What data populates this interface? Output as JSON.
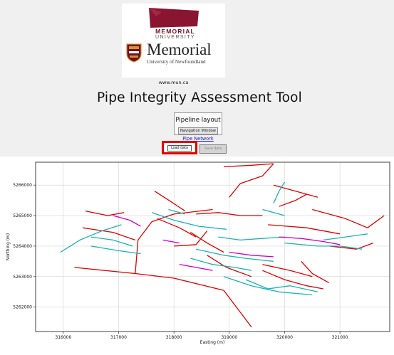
{
  "logo": {
    "banner_line1": "MEMORIAL",
    "banner_line2": "UNIVERSITY",
    "name": "Memorial",
    "subtitle": "University of Newfoundland",
    "url": "www.mun.ca"
  },
  "app": {
    "title": "Pipe Integrity Assessment Tool"
  },
  "panel": {
    "layout_button": "Pipeline layout",
    "navigation_button": "Navigation Window",
    "pipe_network_link": "Pipe Network",
    "load_button": "Load data",
    "save_button": "Save data"
  },
  "colors": {
    "highlight": "#e00000",
    "brand": "#7a0b26",
    "series_red": "#e00000",
    "series_cyan": "#1ab3b3",
    "series_magenta": "#cc00cc"
  },
  "chart_data": {
    "type": "line",
    "title": "",
    "xlabel": "Easting (m)",
    "ylabel": "Northing (m)",
    "xlim": [
      315500,
      321900
    ],
    "ylim": [
      5261200,
      5266750
    ],
    "xticks": [
      316000,
      317000,
      318000,
      319000,
      320000,
      321000
    ],
    "yticks": [
      5262000,
      5263000,
      5264000,
      5265000,
      5266000
    ],
    "grid": true,
    "series": [
      {
        "color": "#e00000",
        "lines": [
          [
            [
              316200,
              5263300
            ],
            [
              317300,
              5263100
            ],
            [
              318000,
              5262950
            ],
            [
              318900,
              5262550
            ],
            [
              319400,
              5261350
            ]
          ],
          [
            [
              317300,
              5263100
            ],
            [
              317350,
              5264200
            ],
            [
              317600,
              5264800
            ]
          ],
          [
            [
              317600,
              5264800
            ],
            [
              318000,
              5265050
            ],
            [
              318700,
              5265200
            ]
          ],
          [
            [
              316350,
              5264600
            ],
            [
              316900,
              5264450
            ],
            [
              317300,
              5264200
            ]
          ],
          [
            [
              318900,
              5266600
            ],
            [
              319400,
              5266650
            ],
            [
              319800,
              5266700
            ]
          ],
          [
            [
              319000,
              5265600
            ],
            [
              319200,
              5266050
            ],
            [
              319600,
              5266300
            ],
            [
              319800,
              5266700
            ]
          ],
          [
            [
              319800,
              5266000
            ],
            [
              320200,
              5265800
            ],
            [
              320600,
              5265600
            ]
          ],
          [
            [
              320500,
              5265200
            ],
            [
              321100,
              5264900
            ],
            [
              321500,
              5264600
            ],
            [
              321800,
              5265000
            ]
          ],
          [
            [
              320800,
              5264000
            ],
            [
              321300,
              5263900
            ],
            [
              321600,
              5264100
            ]
          ],
          [
            [
              318600,
              5264500
            ],
            [
              318400,
              5264050
            ],
            [
              318000,
              5264000
            ]
          ],
          [
            [
              319700,
              5264700
            ],
            [
              320400,
              5264600
            ],
            [
              321000,
              5264400
            ]
          ],
          [
            [
              318600,
              5263700
            ],
            [
              318950,
              5263300
            ],
            [
              319400,
              5263000
            ]
          ],
          [
            [
              319600,
              5263200
            ],
            [
              320000,
              5262900
            ],
            [
              320400,
              5262700
            ],
            [
              320700,
              5262600
            ]
          ],
          [
            [
              319600,
              5263400
            ],
            [
              320100,
              5263200
            ],
            [
              320500,
              5263000
            ]
          ],
          [
            [
              318300,
              5264450
            ],
            [
              318600,
              5264100
            ],
            [
              318900,
              5263800
            ]
          ],
          [
            [
              320800,
              5262800
            ],
            [
              320500,
              5263100
            ],
            [
              320300,
              5263500
            ]
          ],
          [
            [
              318400,
              5265050
            ],
            [
              318800,
              5265100
            ],
            [
              319200,
              5265000
            ],
            [
              319600,
              5265000
            ]
          ],
          [
            [
              317700,
              5264900
            ],
            [
              318100,
              5264600
            ],
            [
              318400,
              5264300
            ]
          ],
          [
            [
              316400,
              5265150
            ],
            [
              316800,
              5265000
            ],
            [
              317100,
              5265100
            ]
          ],
          [
            [
              317650,
              5265800
            ],
            [
              317950,
              5265450
            ],
            [
              318200,
              5265150
            ]
          ],
          [
            [
              319900,
              5265300
            ],
            [
              320200,
              5265500
            ],
            [
              320400,
              5265700
            ]
          ]
        ]
      },
      {
        "color": "#1ab3b3",
        "lines": [
          [
            [
              315950,
              5263800
            ],
            [
              316300,
              5264200
            ],
            [
              316700,
              5264500
            ],
            [
              317050,
              5264700
            ]
          ],
          [
            [
              316500,
              5264300
            ],
            [
              316900,
              5264200
            ],
            [
              317250,
              5264000
            ]
          ],
          [
            [
              316500,
              5264000
            ],
            [
              317000,
              5263850
            ],
            [
              317400,
              5263750
            ]
          ],
          [
            [
              318300,
              5263600
            ],
            [
              318700,
              5263400
            ],
            [
              319100,
              5263300
            ],
            [
              319400,
              5263200
            ]
          ],
          [
            [
              318900,
              5263000
            ],
            [
              319400,
              5262700
            ],
            [
              319900,
              5262500
            ],
            [
              320500,
              5262400
            ]
          ],
          [
            [
              317600,
              5265100
            ],
            [
              318000,
              5264850
            ],
            [
              318450,
              5264650
            ],
            [
              318950,
              5264550
            ]
          ],
          [
            [
              319600,
              5265200
            ],
            [
              320000,
              5265000
            ]
          ],
          [
            [
              320000,
              5264100
            ],
            [
              320600,
              5264000
            ],
            [
              321000,
              5264000
            ],
            [
              321400,
              5263900
            ]
          ],
          [
            [
              318800,
              5264300
            ],
            [
              319200,
              5264200
            ],
            [
              319600,
              5264250
            ],
            [
              320000,
              5264300
            ]
          ],
          [
            [
              319800,
              5265400
            ],
            [
              319900,
              5265800
            ],
            [
              320000,
              5266100
            ]
          ],
          [
            [
              320700,
              5264200
            ],
            [
              321100,
              5264300
            ],
            [
              321500,
              5264400
            ]
          ],
          [
            [
              318400,
              5263900
            ],
            [
              318900,
              5263700
            ],
            [
              319300,
              5263600
            ],
            [
              319800,
              5263500
            ]
          ],
          [
            [
              319300,
              5262900
            ],
            [
              319700,
              5262600
            ],
            [
              320100,
              5262700
            ],
            [
              320600,
              5262500
            ]
          ],
          [
            [
              317900,
              5265200
            ],
            [
              318200,
              5265050
            ]
          ]
        ]
      },
      {
        "color": "#cc00cc",
        "lines": [
          [
            [
              316900,
              5265000
            ],
            [
              317200,
              5264850
            ],
            [
              317400,
              5264650
            ]
          ],
          [
            [
              319000,
              5263800
            ],
            [
              319400,
              5263700
            ],
            [
              319800,
              5263650
            ]
          ],
          [
            [
              319900,
              5264300
            ],
            [
              320300,
              5264250
            ],
            [
              320700,
              5264150
            ],
            [
              321000,
              5264050
            ]
          ],
          [
            [
              318100,
              5263400
            ],
            [
              318400,
              5263300
            ],
            [
              318700,
              5263200
            ]
          ],
          [
            [
              317800,
              5264200
            ],
            [
              318100,
              5264100
            ]
          ]
        ]
      }
    ]
  }
}
